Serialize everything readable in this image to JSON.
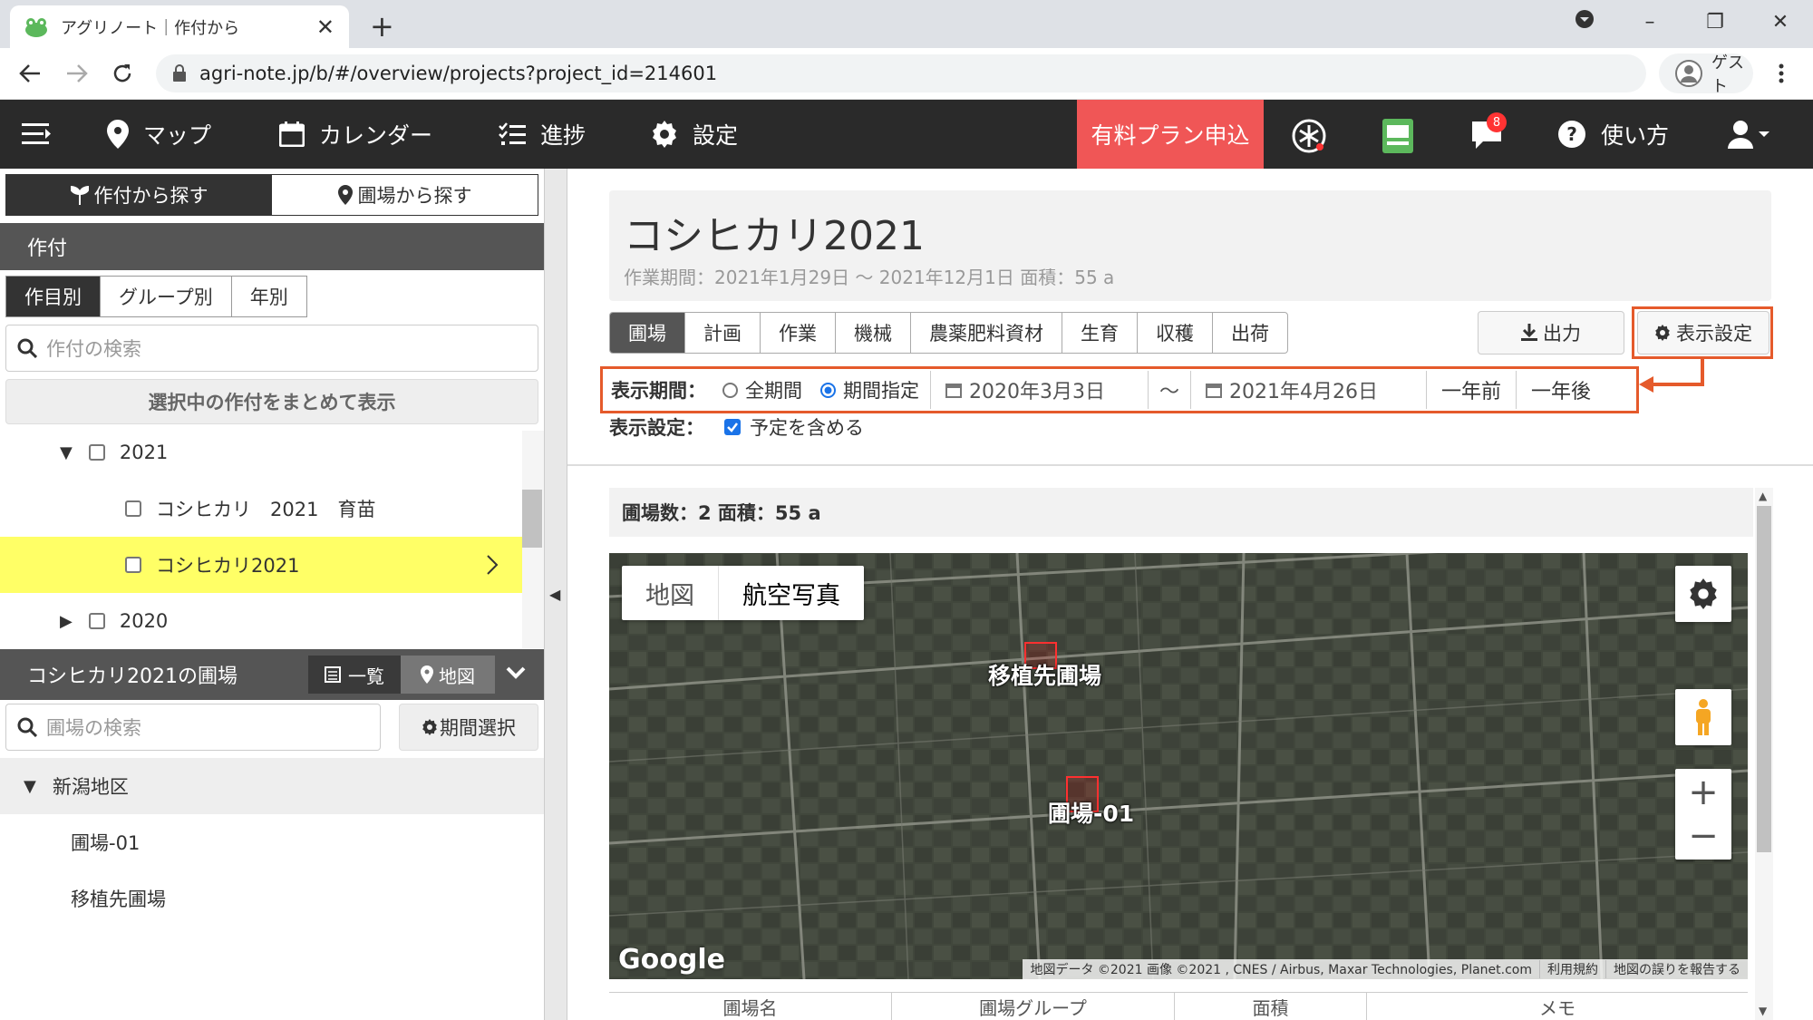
{
  "browser": {
    "tab_title": "アグリノート｜作付から",
    "tab_close": "✕",
    "new_tab": "+",
    "url": "agri-note.jp/b/#/overview/projects?project_id=214601",
    "profile": "ゲスト",
    "window_controls": [
      "–",
      "❐",
      "✕"
    ]
  },
  "nav": {
    "map": "マップ",
    "calendar": "カレンダー",
    "progress": "進捗",
    "settings": "設定",
    "paid_plan": "有料プラン申込",
    "notification_count": "8",
    "help": "使い方",
    "paid_color": "#f05656"
  },
  "left": {
    "search_by_crop": "作付から探す",
    "search_by_field": "圃場から探す",
    "crop_header": "作付",
    "tabs": [
      "作目別",
      "グループ別",
      "年別"
    ],
    "crop_search_placeholder": "作付の検索",
    "show_selected": "選択中の作付をまとめて表示",
    "tree": [
      {
        "label": "2021",
        "expanded": "▼"
      },
      {
        "label": "コシヒカリ　2021　育苗"
      },
      {
        "label": "コシヒカリ2021",
        "selected": true
      },
      {
        "label": "2020",
        "expanded": "▶"
      }
    ],
    "fields_header": "コシヒカリ2021の圃場",
    "view_list": "一覧",
    "view_map": "地図",
    "field_search_placeholder": "圃場の検索",
    "period_select": "期間選択",
    "area": "新潟地区",
    "fields": [
      "圃場-01",
      "移植先圃場"
    ],
    "selected_color": "#ffff66"
  },
  "main": {
    "title": "コシヒカリ2021",
    "period": "作業期間：2021年1月29日 ～ 2021年12月1日  面積：55 a",
    "tabs": [
      "圃場",
      "計画",
      "作業",
      "機械",
      "農薬肥料資材",
      "生育",
      "収穫",
      "出荷"
    ],
    "export": "出力",
    "display_settings": "表示設定",
    "period_label": "表示期間：",
    "all_period": "全期間",
    "specify_period": "期間指定",
    "date_from": "2020年3月3日",
    "tilde": "～",
    "date_to": "2021年4月26日",
    "year_before": "一年前",
    "year_after": "一年後",
    "display_label": "表示設定：",
    "include_plan": "予定を含める",
    "field_count": "圃場数：2 面積：55 a",
    "highlight_color": "#e55a2b"
  },
  "map": {
    "type_map": "地図",
    "type_aerial": "航空写真",
    "field_labels": [
      "移植先圃場",
      "圃場-01"
    ],
    "zoom_in": "+",
    "zoom_out": "−",
    "google": "Google",
    "attribution": "地図データ ©2021 画像 ©2021 , CNES / Airbus, Maxar Technologies, Planet.com",
    "terms": "利用規約",
    "report": "地図の誤りを報告する"
  },
  "table": {
    "headers": [
      "圃場名",
      "圃場グループ",
      "面積",
      "メモ"
    ]
  }
}
